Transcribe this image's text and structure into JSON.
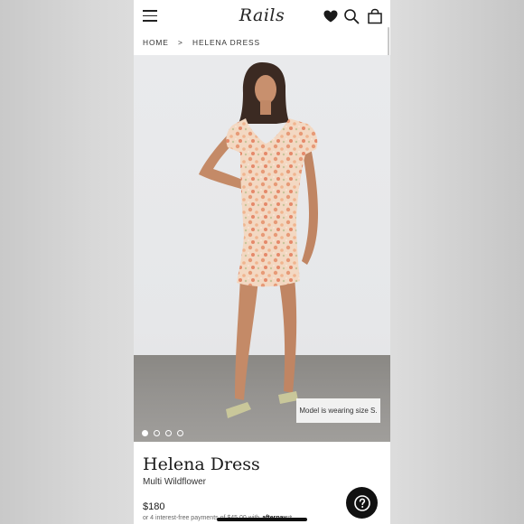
{
  "header": {
    "logo": "Rails",
    "icons": [
      "menu-icon",
      "heart-icon",
      "search-icon",
      "bag-icon"
    ]
  },
  "breadcrumb": {
    "home": "HOME",
    "separator": ">",
    "current": "HELENA DRESS"
  },
  "gallery": {
    "size_note": "Model is wearing size S.",
    "slide_count": 4,
    "active_slide": 1
  },
  "product": {
    "name": "Helena Dress",
    "color": "Multi Wildflower",
    "price": "$180",
    "installments": "or 4 interest-free payments of $45.00 with",
    "installment_brand": "afterpay",
    "installment_mark": "⇄"
  },
  "colors": {
    "text": "#1a1a1a",
    "help_button": "#111111",
    "floor": "#959390"
  }
}
